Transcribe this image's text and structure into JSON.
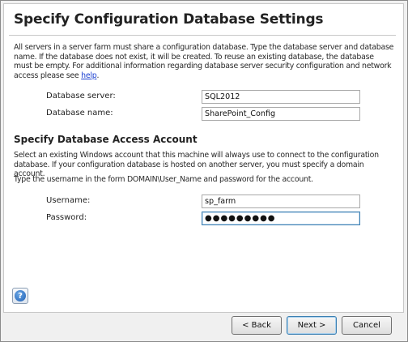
{
  "page": {
    "title": "Specify Configuration Database Settings",
    "intro_text": "All servers in a server farm must share a configuration database. Type the database server and database name. If the database does not exist, it will be created. To reuse an existing database, the database must be empty. For additional information regarding database server security configuration and network access please see ",
    "intro_link": "help",
    "intro_end": "."
  },
  "database": {
    "server_label": "Database server:",
    "server_value": "SQL2012",
    "name_label": "Database name:",
    "name_value": "SharePoint_Config"
  },
  "account": {
    "section_title": "Specify Database Access Account",
    "description": "Select an existing Windows account that this machine will always use to connect to the configuration database. If your configuration database is hosted on another server, you must specify a domain account.",
    "format_hint": "Type the username in the form DOMAIN\\User_Name and password for the account.",
    "username_label": "Username:",
    "username_value": "sp_farm",
    "password_label": "Password:",
    "password_value": "●●●●●●●●●"
  },
  "footer": {
    "help_icon": "question-mark-icon",
    "back_label": "< Back",
    "next_label": "Next >",
    "cancel_label": "Cancel"
  },
  "colors": {
    "link": "#1a3fd1",
    "focus_border": "#3c7fb1"
  }
}
